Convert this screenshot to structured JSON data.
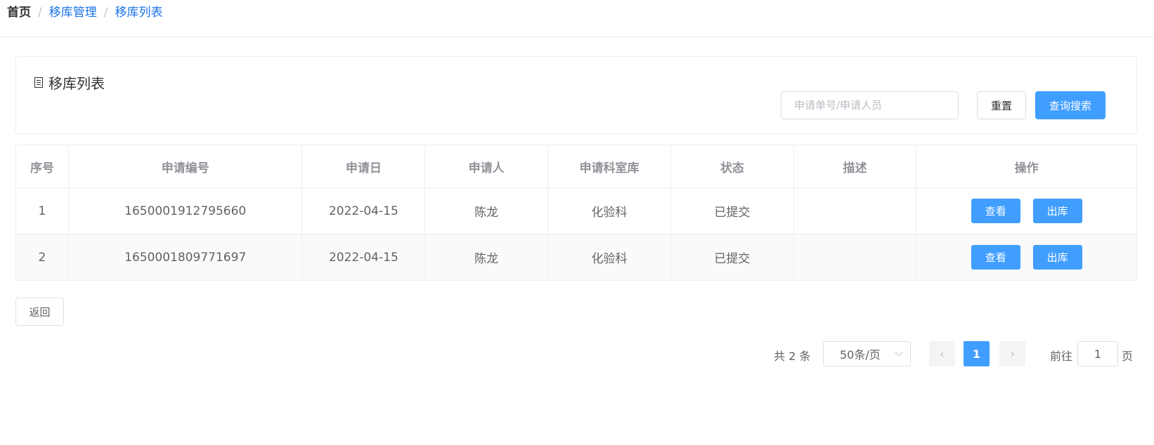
{
  "breadcrumb": {
    "home": "首页",
    "sep": "/",
    "level1": "移库管理",
    "level2": "移库列表"
  },
  "card": {
    "title": "移库列表",
    "icon": "document-icon"
  },
  "search": {
    "placeholder": "申请单号/申请人员",
    "value": "",
    "reset_label": "重置",
    "search_label": "查询搜索"
  },
  "table": {
    "headers": [
      "序号",
      "申请编号",
      "申请日",
      "申请人",
      "申请科室库",
      "状态",
      "描述",
      "操作"
    ],
    "rows": [
      {
        "index": "1",
        "code": "1650001912795660",
        "date": "2022-04-15",
        "applicant": "陈龙",
        "dept": "化验科",
        "status": "已提交",
        "desc": "",
        "view_label": "查看",
        "out_label": "出库"
      },
      {
        "index": "2",
        "code": "1650001809771697",
        "date": "2022-04-15",
        "applicant": "陈龙",
        "dept": "化验科",
        "status": "已提交",
        "desc": "",
        "view_label": "查看",
        "out_label": "出库"
      }
    ]
  },
  "back_label": "返回",
  "pagination": {
    "total_text": "共 2 条",
    "page_size": "50条/页",
    "prev_icon": "chevron-left-icon",
    "next_icon": "chevron-right-icon",
    "prev_glyph": "‹",
    "next_glyph": "›",
    "current_page": "1",
    "goto_label": "前往",
    "goto_value": "1",
    "page_suffix": "页"
  },
  "colors": {
    "primary": "#409eff",
    "link": "#1a73e8",
    "border": "#ebeef5"
  }
}
